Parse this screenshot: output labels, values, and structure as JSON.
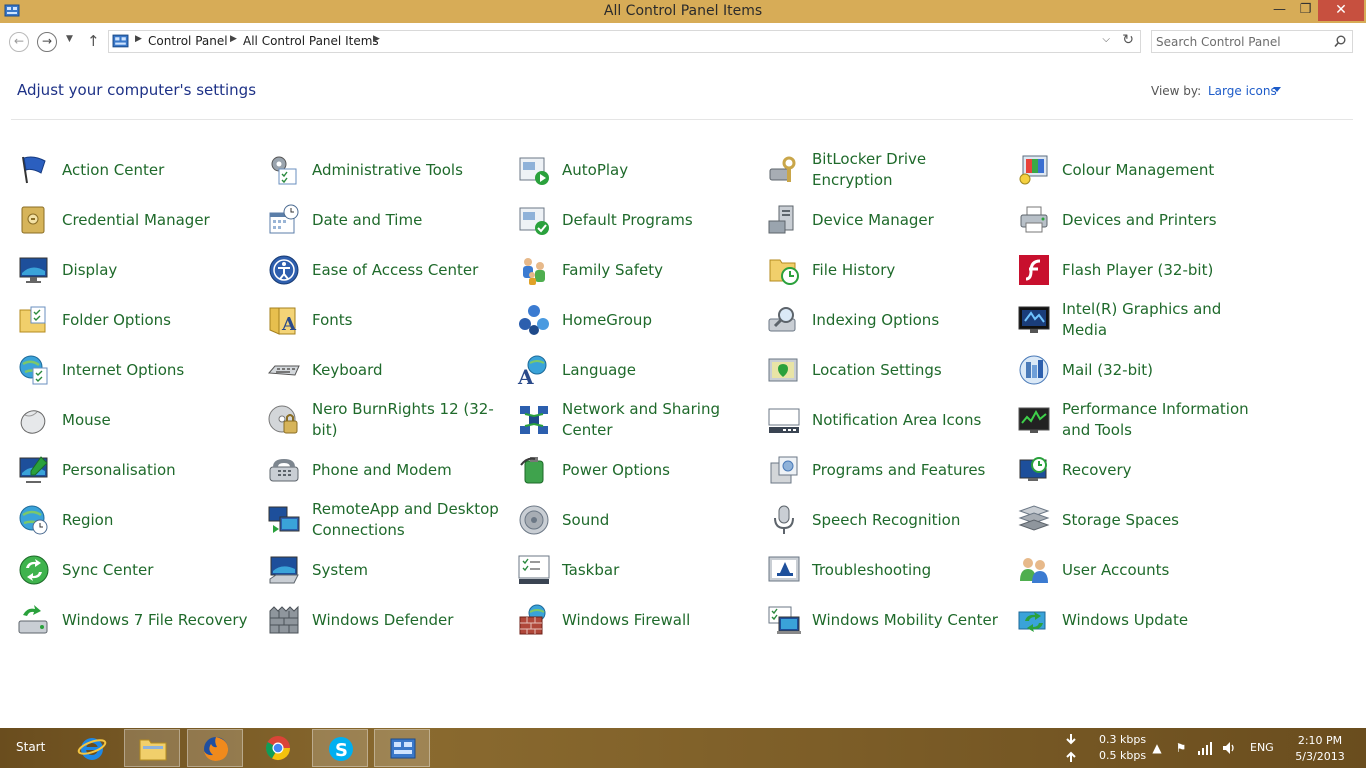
{
  "window": {
    "title": "All Control Panel Items",
    "minimize": "—",
    "maximize": "❐",
    "close": "✕"
  },
  "address": {
    "crumbs": [
      "Control Panel",
      "All Control Panel Items"
    ],
    "search_placeholder": "Search Control Panel"
  },
  "header": {
    "title": "Adjust your computer's settings",
    "view_by_label": "View by:",
    "view_by_value": "Large icons"
  },
  "items": [
    [
      "Action Center",
      "Administrative Tools",
      "AutoPlay",
      "BitLocker Drive Encryption",
      "Colour Management"
    ],
    [
      "Credential Manager",
      "Date and Time",
      "Default Programs",
      "Device Manager",
      "Devices and Printers"
    ],
    [
      "Display",
      "Ease of Access Center",
      "Family Safety",
      "File History",
      "Flash Player (32-bit)"
    ],
    [
      "Folder Options",
      "Fonts",
      "HomeGroup",
      "Indexing Options",
      "Intel(R) Graphics and Media"
    ],
    [
      "Internet Options",
      "Keyboard",
      "Language",
      "Location Settings",
      "Mail (32-bit)"
    ],
    [
      "Mouse",
      "Nero BurnRights 12 (32-bit)",
      "Network and Sharing Center",
      "Notification Area Icons",
      "Performance Information and Tools"
    ],
    [
      "Personalisation",
      "Phone and Modem",
      "Power Options",
      "Programs and Features",
      "Recovery"
    ],
    [
      "Region",
      "RemoteApp and Desktop Connections",
      "Sound",
      "Speech Recognition",
      "Storage Spaces"
    ],
    [
      "Sync Center",
      "System",
      "Taskbar",
      "Troubleshooting",
      "User Accounts"
    ],
    [
      "Windows 7 File Recovery",
      "Windows Defender",
      "Windows Firewall",
      "Windows Mobility Center",
      "Windows Update"
    ]
  ],
  "taskbar": {
    "start_label": "Start",
    "apps": [
      "internet-explorer-icon",
      "file-explorer-icon",
      "firefox-icon",
      "chrome-icon",
      "skype-icon",
      "control-panel-icon"
    ],
    "down_speed": "0.3 kbps",
    "up_speed": "0.5 kbps",
    "language": "ENG",
    "time": "2:10 PM",
    "date": "5/3/2013"
  },
  "colors": {
    "titlebar": "#d7ac57",
    "close_button": "#c7503f",
    "item_link": "#1f6a2b",
    "heading": "#1e3287",
    "accent_link": "#1e5cc9"
  }
}
